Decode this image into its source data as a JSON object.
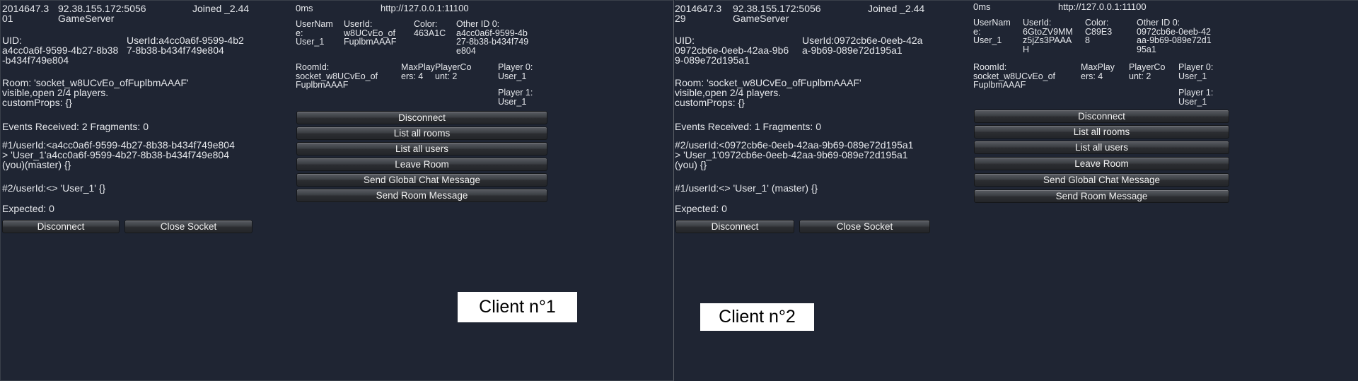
{
  "clients": [
    {
      "id_line": "2014647.3\n01",
      "server_line": "92.38.155.172:5056\nGameServer",
      "joined_text": "Joined _2.44",
      "uid_label": "UID:\na4cc0a6f-9599-4b27-8b38\n-b434f749e804",
      "userid_text": "UserId:a4cc0a6f-9599-4b2\n7-8b38-b434f749e804",
      "room_text": "Room: 'socket_w8UCvEo_ofFuplbmAAAF'\nvisible,open 2/4 players.\ncustomProps: {}",
      "events_text": "Events Received: 2 Fragments: 0",
      "player1_text": "#1/userId:<a4cc0a6f-9599-4b27-8b38-b434f749e804\n> 'User_1'a4cc0a6f-9599-4b27-8b38-b434f749e804\n(you)(master) {}",
      "player2_text": "#2/userId:<> 'User_1'  {}",
      "expected_text": "Expected: 0",
      "disconnect_label": "Disconnect",
      "close_socket_label": "Close Socket",
      "ping": "0ms",
      "url": "http://127.0.0.1:11100",
      "user_table": {
        "username": "UserNam\ne:\nUser_1",
        "userid": "UserId:\nw8UCvEo_of\nFuplbmAAAF",
        "color": "Color:\n463A1C",
        "other_id": "Other ID 0:\na4cc0a6f-9599-4b\n27-8b38-b434f749\ne804"
      },
      "room_table": {
        "roomid": "RoomId:\nsocket_w8UCvEo_of\nFuplbmAAAF",
        "maxplayers": "MaxPlay\ners: 4",
        "playercount": "PlayerCo\nunt: 2",
        "player0": "Player 0:\nUser_1",
        "player1": "Player 1:\nUser_1"
      },
      "actions": [
        "Disconnect",
        "List all rooms",
        "List all users",
        "Leave Room",
        "Send Global Chat Message",
        "Send Room Message"
      ],
      "caption": "Client n°1"
    },
    {
      "id_line": "2014647.3\n29",
      "server_line": "92.38.155.172:5056\nGameServer",
      "joined_text": "Joined _2.44",
      "uid_label": "UID:\n0972cb6e-0eeb-42aa-9b6\n9-089e72d195a1",
      "userid_text": "UserId:0972cb6e-0eeb-42a\na-9b69-089e72d195a1",
      "room_text": "Room: 'socket_w8UCvEo_ofFuplbmAAAF'\nvisible,open 2/4 players.\ncustomProps: {}",
      "events_text": "Events Received: 1 Fragments: 0",
      "player1_text": "#2/userId:<0972cb6e-0eeb-42aa-9b69-089e72d195a1\n> 'User_1'0972cb6e-0eeb-42aa-9b69-089e72d195a1\n(you) {}",
      "player2_text": "#1/userId:<> 'User_1' (master) {}",
      "expected_text": "Expected: 0",
      "disconnect_label": "Disconnect",
      "close_socket_label": "Close Socket",
      "ping": "0ms",
      "url": "http://127.0.0.1:11100",
      "user_table": {
        "username": "UserNam\ne:\nUser_1",
        "userid": "UserId:\n6GtoZV9MM\nz5jZs3PAAA\nH",
        "color": "Color:\nC89E3\n8",
        "other_id": "Other ID 0:\n0972cb6e-0eeb-42\naa-9b69-089e72d1\n95a1"
      },
      "room_table": {
        "roomid": "RoomId:\nsocket_w8UCvEo_of\nFuplbmAAAF",
        "maxplayers": "MaxPlay\ners: 4",
        "playercount": "PlayerCo\nunt: 2",
        "player0": "Player 0:\nUser_1",
        "player1": "Player 1:\nUser_1"
      },
      "actions": [
        "Disconnect",
        "List all rooms",
        "List all users",
        "Leave Room",
        "Send Global Chat Message",
        "Send Room Message"
      ],
      "caption": "Client n°2"
    }
  ],
  "colors": {
    "background": "#1f2533",
    "text": "#e6e8ec",
    "button_top": "#5a5d63",
    "button_bottom": "#24262a"
  }
}
